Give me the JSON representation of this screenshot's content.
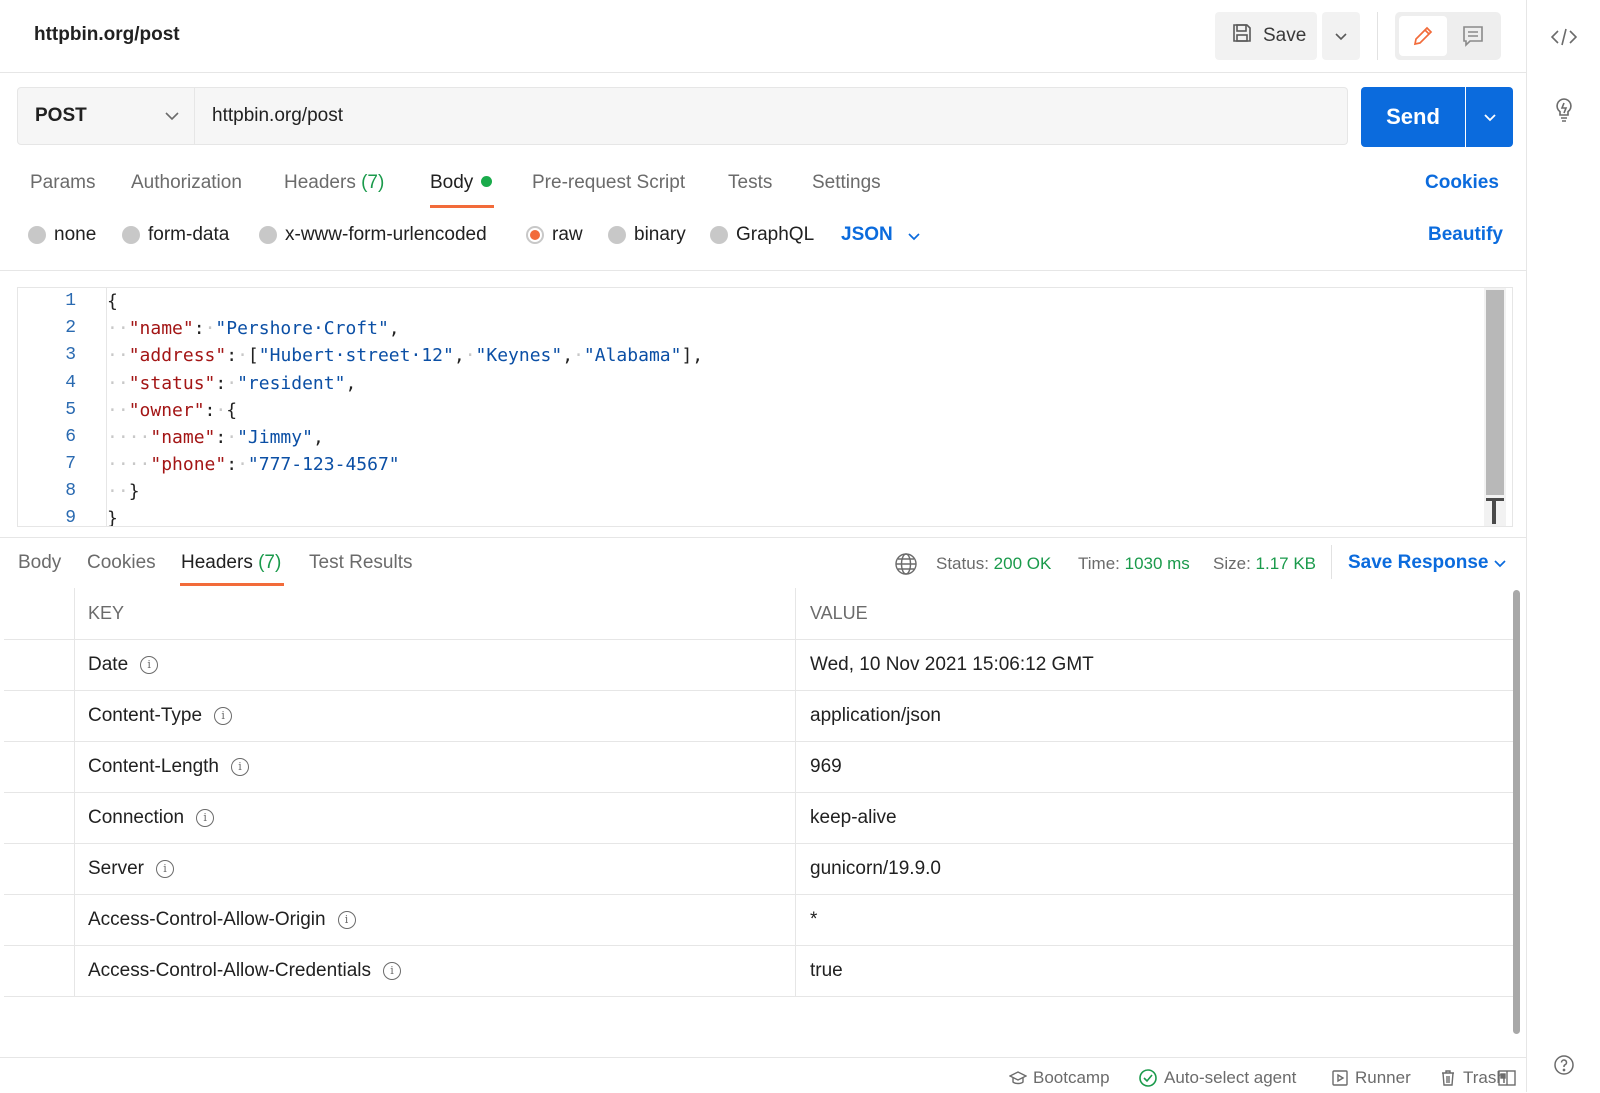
{
  "tab": {
    "title": "httpbin.org/post"
  },
  "toolbar": {
    "save_label": "Save"
  },
  "request": {
    "method": "POST",
    "url": "httpbin.org/post",
    "send_label": "Send"
  },
  "request_tabs": {
    "params": "Params",
    "authorization": "Authorization",
    "headers": "Headers",
    "headers_count": "(7)",
    "body": "Body",
    "prerequest": "Pre-request Script",
    "tests": "Tests",
    "settings": "Settings",
    "cookies": "Cookies"
  },
  "body_types": {
    "none": "none",
    "form_data": "form-data",
    "urlencoded": "x-www-form-urlencoded",
    "raw": "raw",
    "binary": "binary",
    "graphql": "GraphQL",
    "format": "JSON",
    "beautify": "Beautify"
  },
  "editor": {
    "line_numbers": [
      "1",
      "2",
      "3",
      "4",
      "5",
      "6",
      "7",
      "8",
      "9"
    ]
  },
  "response_tabs": {
    "body": "Body",
    "cookies": "Cookies",
    "headers": "Headers",
    "headers_count": "(7)",
    "test_results": "Test Results"
  },
  "response_status": {
    "status_label": "Status:",
    "status_value": "200 OK",
    "time_label": "Time:",
    "time_value": "1030 ms",
    "size_label": "Size:",
    "size_value": "1.17 KB",
    "save_response": "Save Response"
  },
  "headers_table": {
    "col_key": "KEY",
    "col_value": "VALUE",
    "rows": [
      {
        "key": "Date",
        "value": "Wed, 10 Nov 2021 15:06:12 GMT"
      },
      {
        "key": "Content-Type",
        "value": "application/json"
      },
      {
        "key": "Content-Length",
        "value": "969"
      },
      {
        "key": "Connection",
        "value": "keep-alive"
      },
      {
        "key": "Server",
        "value": "gunicorn/19.9.0"
      },
      {
        "key": "Access-Control-Allow-Origin",
        "value": "*"
      },
      {
        "key": "Access-Control-Allow-Credentials",
        "value": "true"
      }
    ]
  },
  "footer": {
    "bootcamp": "Bootcamp",
    "agent": "Auto-select agent",
    "runner": "Runner",
    "trash": "Trash"
  },
  "colors": {
    "accent_orange": "#f26b3a",
    "primary_blue": "#0b6bdd",
    "success_green": "#1a9a4b"
  }
}
